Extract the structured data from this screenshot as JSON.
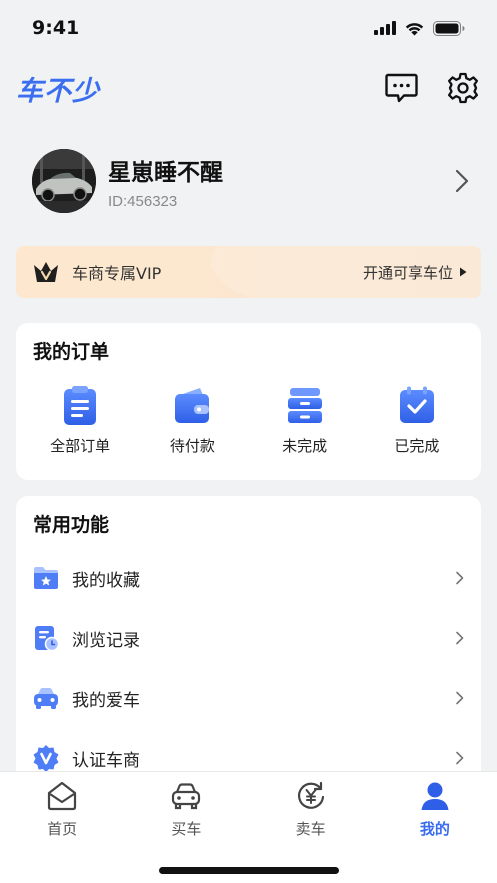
{
  "status_bar": {
    "time": "9:41"
  },
  "header": {
    "logo": "车不少"
  },
  "profile": {
    "name": "星崽睡不醒",
    "id": "ID:456323"
  },
  "vip": {
    "label": "车商专属VIP",
    "cta": "开通可享车位"
  },
  "orders": {
    "title": "我的订单",
    "items": [
      {
        "label": "全部订单",
        "icon": "order-list-icon"
      },
      {
        "label": "待付款",
        "icon": "wallet-icon"
      },
      {
        "label": "未完成",
        "icon": "drawer-icon"
      },
      {
        "label": "已完成",
        "icon": "clipboard-check-icon"
      }
    ]
  },
  "features": {
    "title": "常用功能",
    "items": [
      {
        "label": "我的收藏",
        "icon": "folder-star-icon"
      },
      {
        "label": "浏览记录",
        "icon": "history-doc-icon"
      },
      {
        "label": "我的爱车",
        "icon": "car-icon"
      },
      {
        "label": "认证车商",
        "icon": "verified-badge-icon"
      }
    ]
  },
  "tabbar": {
    "items": [
      {
        "label": "首页",
        "icon": "home-icon",
        "active": false
      },
      {
        "label": "买车",
        "icon": "car-outline-icon",
        "active": false
      },
      {
        "label": "卖车",
        "icon": "yuan-exchange-icon",
        "active": false
      },
      {
        "label": "我的",
        "icon": "user-icon",
        "active": true
      }
    ]
  },
  "colors": {
    "accent": "#3a6cf0",
    "vip_bg": "#fde8cf",
    "page_bg": "#f0f2f4"
  }
}
